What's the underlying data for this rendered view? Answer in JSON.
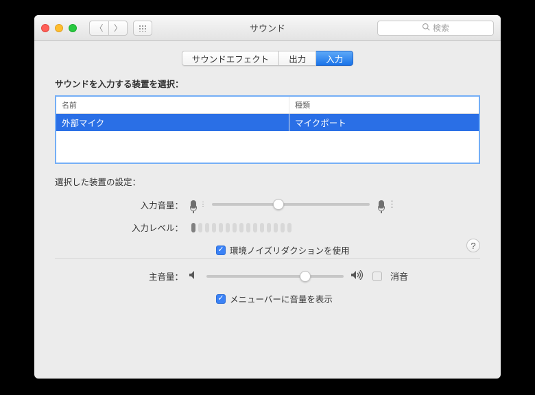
{
  "window": {
    "title": "サウンド"
  },
  "search": {
    "placeholder": "検索"
  },
  "tabs": {
    "effects": "サウンドエフェクト",
    "output": "出力",
    "input": "入力"
  },
  "input_panel": {
    "select_device_label": "サウンドを入力する装置を選択：",
    "columns": {
      "name": "名前",
      "type": "種類"
    },
    "devices": [
      {
        "name": "外部マイク",
        "type": "マイクポート"
      }
    ],
    "settings_label": "選択した装置の設定：",
    "input_volume_label": "入力音量：",
    "input_volume_percent": 42,
    "input_level_label": "入力レベル：",
    "input_level_active_segments": 1,
    "input_level_total_segments": 15,
    "noise_reduction_label": "環境ノイズリダクションを使用",
    "noise_reduction_checked": true
  },
  "main_volume": {
    "label": "主音量：",
    "percent": 72,
    "mute_label": "消音",
    "mute_checked": false,
    "show_in_menubar_label": "メニューバーに音量を表示",
    "show_in_menubar_checked": true
  }
}
